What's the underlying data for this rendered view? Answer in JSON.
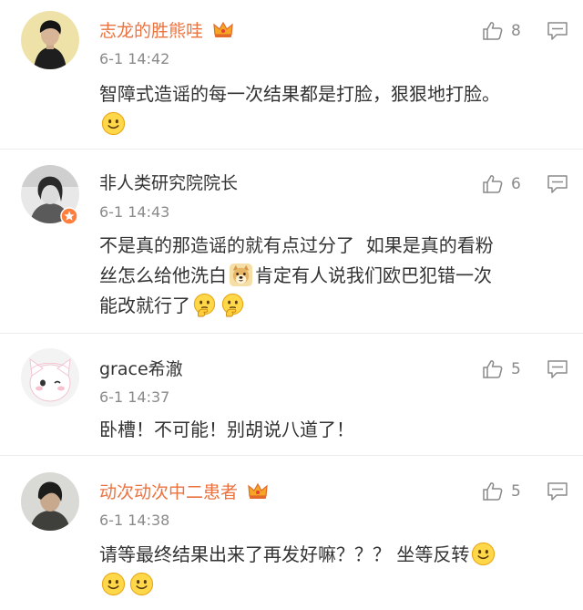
{
  "comments": [
    {
      "author": "志龙的胜熊哇",
      "vip": true,
      "time": "6-1 14:42",
      "likes": "8",
      "body": [
        {
          "t": "text",
          "v": "智障式造谣的每一次结果都是打脸，狠狠地打脸。"
        },
        {
          "t": "br"
        },
        {
          "t": "emoji",
          "name": "smile-emoji"
        }
      ]
    },
    {
      "author": "非人类研究院院长",
      "vip": false,
      "time": "6-1 14:43",
      "likes": "6",
      "body": [
        {
          "t": "text",
          "v": "不是真的那造谣的就有点过分了  如果是真的看粉"
        },
        {
          "t": "br"
        },
        {
          "t": "text",
          "v": "丝怎么给他洗白"
        },
        {
          "t": "emoji",
          "name": "doge-emoji"
        },
        {
          "t": "text",
          "v": "肯定有人说我们欧巴犯错一次"
        },
        {
          "t": "br"
        },
        {
          "t": "text",
          "v": "能改就行了"
        },
        {
          "t": "emoji",
          "name": "thinking-emoji"
        },
        {
          "t": "emoji",
          "name": "thinking-emoji"
        }
      ]
    },
    {
      "author": "grace希澈",
      "vip": false,
      "time": "6-1 14:37",
      "likes": "5",
      "body": [
        {
          "t": "text",
          "v": "卧槽！不可能！别胡说八道了！"
        }
      ]
    },
    {
      "author": "动次动次中二患者",
      "vip": true,
      "time": "6-1 14:38",
      "likes": "5",
      "body": [
        {
          "t": "text",
          "v": "请等最终结果出来了再发好嘛？？？ 坐等反转"
        },
        {
          "t": "emoji",
          "name": "smile-emoji"
        },
        {
          "t": "br"
        },
        {
          "t": "emoji",
          "name": "smile-emoji"
        },
        {
          "t": "emoji",
          "name": "smile-emoji"
        }
      ]
    }
  ],
  "icons": {
    "like": "thumbs-up-icon",
    "reply": "comment-icon",
    "vip": "crown-icon"
  },
  "colors": {
    "vip_name": "#eb7340",
    "normal_name": "#333333",
    "meta": "#8a8a8a",
    "divider": "#ececec"
  }
}
